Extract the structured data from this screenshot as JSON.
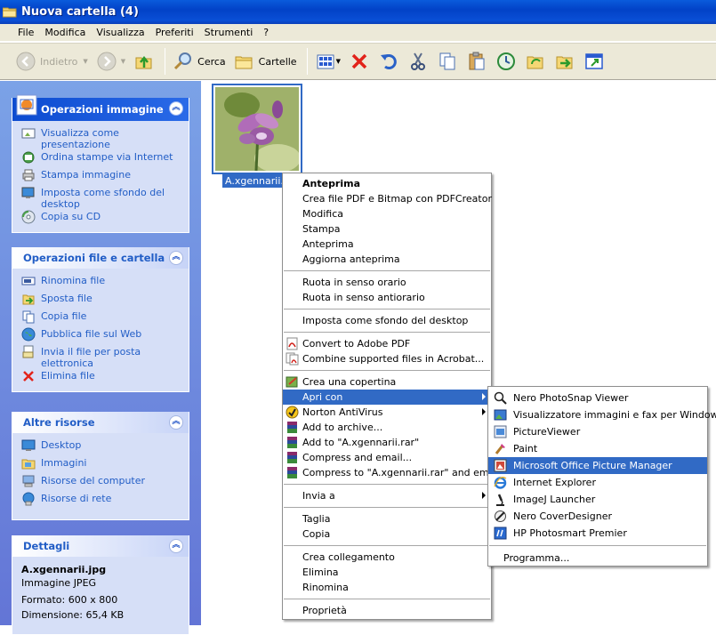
{
  "window": {
    "title": "Nuova cartella (4)"
  },
  "menubar": [
    "File",
    "Modifica",
    "Visualizza",
    "Preferiti",
    "Strumenti",
    "?"
  ],
  "toolbar": {
    "back": "Indietro",
    "search": "Cerca",
    "folders": "Cartelle"
  },
  "panels": {
    "image": {
      "title": "Operazioni immagine",
      "items": [
        "Visualizza come presentazione",
        "Ordina stampe via Internet",
        "Stampa immagine",
        "Imposta come sfondo del desktop",
        "Copia su CD"
      ]
    },
    "file": {
      "title": "Operazioni file e cartella",
      "items": [
        "Rinomina file",
        "Sposta file",
        "Copia file",
        "Pubblica file sul Web",
        "Invia il file per posta elettronica",
        "Elimina file"
      ]
    },
    "other": {
      "title": "Altre risorse",
      "items": [
        "Desktop",
        "Immagini",
        "Risorse del computer",
        "Risorse di rete"
      ]
    },
    "details": {
      "title": "Dettagli",
      "name": "A.xgennarii.jpg",
      "type": "Immagine JPEG",
      "format": "Formato: 600 x 800",
      "size": "Dimensione: 65,4 KB"
    }
  },
  "file": {
    "label": "A.xgennarii.jpg",
    "visible_label": "A.xgennarii.jp"
  },
  "context_menu": {
    "g1": [
      "Anteprima",
      "Crea file PDF e Bitmap con PDFCreator",
      "Modifica",
      "Stampa",
      "Anteprima",
      "Aggiorna anteprima"
    ],
    "g2": [
      "Ruota in senso orario",
      "Ruota in senso antiorario"
    ],
    "g3": [
      "Imposta come sfondo del desktop"
    ],
    "g4": [
      "Convert to Adobe PDF",
      "Combine supported files in Acrobat..."
    ],
    "g5": [
      "Crea una copertina",
      "Apri con",
      "Norton AntiVirus",
      "Add to archive...",
      "Add to \"A.xgennarii.rar\"",
      "Compress and email...",
      "Compress to \"A.xgennarii.rar\" and email"
    ],
    "g6": [
      "Invia a"
    ],
    "g7": [
      "Taglia",
      "Copia"
    ],
    "g8": [
      "Crea collegamento",
      "Elimina",
      "Rinomina"
    ],
    "g9": [
      "Proprietà"
    ]
  },
  "open_with": {
    "items": [
      "Nero PhotoSnap Viewer",
      "Visualizzatore immagini e fax per Windows",
      "PictureViewer",
      "Paint",
      "Microsoft Office Picture Manager",
      "Internet Explorer",
      "ImageJ Launcher",
      "Nero CoverDesigner",
      "HP Photosmart Premier"
    ],
    "more": "Programma..."
  },
  "colors": {
    "selection": "#316ac5",
    "title_bar": "#0a4fd6",
    "task_pane": "#6375d6",
    "link": "#215dc6"
  }
}
